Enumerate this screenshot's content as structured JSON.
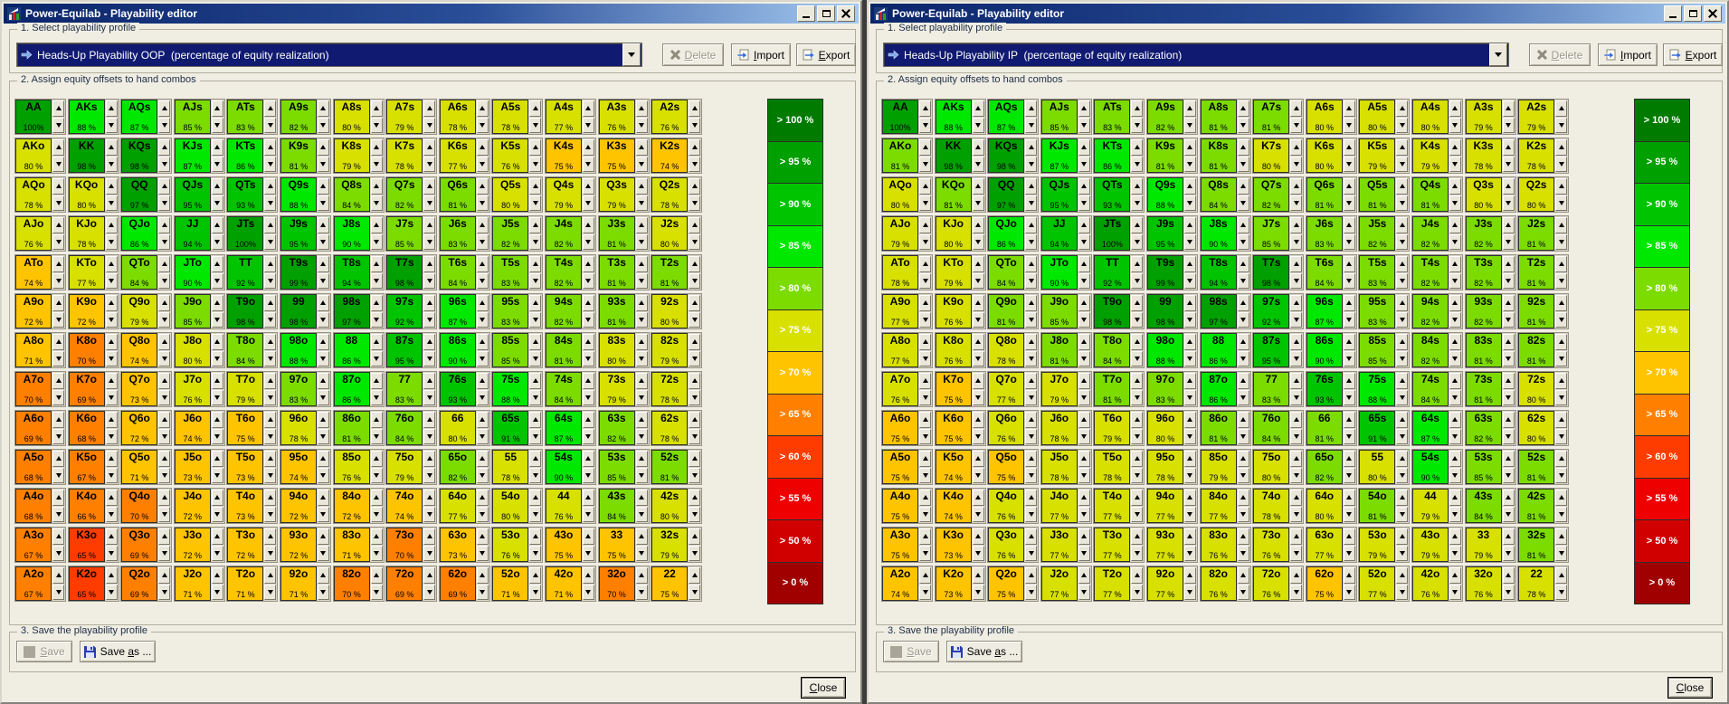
{
  "app": {
    "title": "Power-Equilab - Playability editor",
    "icons": {
      "app": "chart-icon",
      "minimize": "minimize-icon",
      "maximize": "maximize-icon",
      "close_window": "x-icon",
      "dropdown_item": "blue-arrow-icon",
      "dropdown_open": "chevron-down-icon",
      "delete": "x-icon",
      "import": "page-arrow-icon",
      "export": "page-arrow-icon",
      "save": "gray-disk-icon",
      "save_as": "floppy-disk-icon",
      "spin_up": "up-arrow-icon",
      "spin_down": "down-arrow-icon"
    }
  },
  "sections": {
    "profile": "1. Select playability profile",
    "grid": "2. Assign equity offsets to hand combos",
    "save": "3. Save the playability profile"
  },
  "buttons": {
    "delete": {
      "label": "Delete",
      "underline": 0,
      "enabled": false
    },
    "import": {
      "label": "Import",
      "underline": 0,
      "enabled": true
    },
    "export": {
      "label": "Export",
      "underline": 0,
      "enabled": true
    },
    "save": {
      "label": "Save",
      "underline": 0,
      "enabled": false
    },
    "save_as": {
      "label": "Save as ...",
      "underline": 5,
      "enabled": true
    },
    "close": {
      "label": "Close",
      "underline": 0,
      "enabled": true
    }
  },
  "legend": {
    "labels": [
      "> 100 %",
      "> 95 %",
      "> 90 %",
      "> 85 %",
      "> 80 %",
      "> 75 %",
      "> 70 %",
      "> 65 %",
      "> 60 %",
      "> 55 %",
      "> 50 %",
      "> 0 %"
    ],
    "colors": [
      "#007B00",
      "#00A000",
      "#00C400",
      "#00E800",
      "#7CDC00",
      "#D8E000",
      "#FFC400",
      "#FF8000",
      "#FF3C00",
      "#EE0000",
      "#D00000",
      "#A00000"
    ],
    "thresholds": [
      100,
      95,
      90,
      85,
      80,
      75,
      70,
      65,
      60,
      55,
      50,
      0
    ]
  },
  "hands": [
    [
      "AA",
      "AKs",
      "AQs",
      "AJs",
      "ATs",
      "A9s",
      "A8s",
      "A7s",
      "A6s",
      "A5s",
      "A4s",
      "A3s",
      "A2s"
    ],
    [
      "AKo",
      "KK",
      "KQs",
      "KJs",
      "KTs",
      "K9s",
      "K8s",
      "K7s",
      "K6s",
      "K5s",
      "K4s",
      "K3s",
      "K2s"
    ],
    [
      "AQo",
      "KQo",
      "QQ",
      "QJs",
      "QTs",
      "Q9s",
      "Q8s",
      "Q7s",
      "Q6s",
      "Q5s",
      "Q4s",
      "Q3s",
      "Q2s"
    ],
    [
      "AJo",
      "KJo",
      "QJo",
      "JJ",
      "JTs",
      "J9s",
      "J8s",
      "J7s",
      "J6s",
      "J5s",
      "J4s",
      "J3s",
      "J2s"
    ],
    [
      "ATo",
      "KTo",
      "QTo",
      "JTo",
      "TT",
      "T9s",
      "T8s",
      "T7s",
      "T6s",
      "T5s",
      "T4s",
      "T3s",
      "T2s"
    ],
    [
      "A9o",
      "K9o",
      "Q9o",
      "J9o",
      "T9o",
      "99",
      "98s",
      "97s",
      "96s",
      "95s",
      "94s",
      "93s",
      "92s"
    ],
    [
      "A8o",
      "K8o",
      "Q8o",
      "J8o",
      "T8o",
      "98o",
      "88",
      "87s",
      "86s",
      "85s",
      "84s",
      "83s",
      "82s"
    ],
    [
      "A7o",
      "K7o",
      "Q7o",
      "J7o",
      "T7o",
      "97o",
      "87o",
      "77",
      "76s",
      "75s",
      "74s",
      "73s",
      "72s"
    ],
    [
      "A6o",
      "K6o",
      "Q6o",
      "J6o",
      "T6o",
      "96o",
      "86o",
      "76o",
      "66",
      "65s",
      "64s",
      "63s",
      "62s"
    ],
    [
      "A5o",
      "K5o",
      "Q5o",
      "J5o",
      "T5o",
      "95o",
      "85o",
      "75o",
      "65o",
      "55",
      "54s",
      "53s",
      "52s"
    ],
    [
      "A4o",
      "K4o",
      "Q4o",
      "J4o",
      "T4o",
      "94o",
      "84o",
      "74o",
      "64o",
      "54o",
      "44",
      "43s",
      "42s"
    ],
    [
      "A3o",
      "K3o",
      "Q3o",
      "J3o",
      "T3o",
      "93o",
      "83o",
      "73o",
      "63o",
      "53o",
      "43o",
      "33",
      "32s"
    ],
    [
      "A2o",
      "K2o",
      "Q2o",
      "J2o",
      "T2o",
      "92o",
      "82o",
      "72o",
      "62o",
      "52o",
      "42o",
      "32o",
      "22"
    ]
  ],
  "windows": [
    {
      "title": "Power-Equilab - Playability editor",
      "profile": "Heads-Up Playability OOP  (percentage of equity realization)",
      "values": [
        [
          100,
          88,
          87,
          85,
          83,
          82,
          80,
          79,
          78,
          78,
          77,
          76,
          76
        ],
        [
          80,
          98,
          98,
          87,
          86,
          81,
          79,
          78,
          77,
          76,
          75,
          75,
          74
        ],
        [
          78,
          80,
          97,
          95,
          93,
          88,
          84,
          82,
          81,
          80,
          79,
          79,
          78
        ],
        [
          76,
          78,
          86,
          94,
          100,
          95,
          90,
          85,
          83,
          82,
          82,
          81,
          80
        ],
        [
          74,
          77,
          84,
          90,
          92,
          99,
          94,
          98,
          84,
          83,
          82,
          81,
          81
        ],
        [
          72,
          72,
          79,
          85,
          98,
          98,
          97,
          92,
          87,
          83,
          82,
          81,
          80
        ],
        [
          71,
          70,
          74,
          80,
          84,
          88,
          86,
          95,
          90,
          85,
          81,
          80,
          79
        ],
        [
          70,
          69,
          73,
          76,
          79,
          83,
          86,
          83,
          93,
          88,
          84,
          79,
          78
        ],
        [
          69,
          68,
          72,
          74,
          75,
          78,
          81,
          84,
          80,
          91,
          87,
          82,
          78
        ],
        [
          68,
          67,
          71,
          73,
          73,
          74,
          76,
          79,
          82,
          78,
          90,
          85,
          81
        ],
        [
          68,
          66,
          70,
          72,
          73,
          72,
          72,
          74,
          77,
          80,
          76,
          84,
          80
        ],
        [
          67,
          65,
          69,
          72,
          72,
          72,
          71,
          70,
          73,
          76,
          75,
          75,
          79
        ],
        [
          67,
          65,
          69,
          71,
          71,
          71,
          70,
          69,
          69,
          71,
          71,
          70,
          75
        ]
      ]
    },
    {
      "title": "Power-Equilab - Playability editor",
      "profile": "Heads-Up Playability IP  (percentage of equity realization)",
      "values": [
        [
          100,
          88,
          87,
          85,
          83,
          82,
          81,
          81,
          80,
          80,
          80,
          79,
          79
        ],
        [
          81,
          98,
          98,
          87,
          86,
          81,
          81,
          80,
          80,
          79,
          79,
          78,
          78
        ],
        [
          80,
          81,
          97,
          95,
          93,
          88,
          84,
          82,
          81,
          81,
          81,
          80,
          80
        ],
        [
          79,
          80,
          86,
          94,
          100,
          95,
          90,
          85,
          83,
          82,
          82,
          82,
          81
        ],
        [
          78,
          79,
          84,
          90,
          92,
          99,
          94,
          98,
          84,
          83,
          82,
          82,
          81
        ],
        [
          77,
          76,
          81,
          85,
          98,
          98,
          97,
          92,
          87,
          83,
          82,
          82,
          81
        ],
        [
          77,
          76,
          78,
          81,
          84,
          88,
          86,
          95,
          90,
          85,
          82,
          81,
          81
        ],
        [
          76,
          75,
          77,
          79,
          81,
          83,
          86,
          83,
          93,
          88,
          84,
          81,
          80
        ],
        [
          75,
          75,
          76,
          78,
          79,
          80,
          81,
          84,
          81,
          91,
          87,
          82,
          80
        ],
        [
          75,
          74,
          75,
          78,
          78,
          78,
          79,
          80,
          82,
          80,
          90,
          85,
          81
        ],
        [
          75,
          74,
          76,
          77,
          77,
          77,
          77,
          78,
          80,
          81,
          79,
          84,
          81
        ],
        [
          75,
          73,
          76,
          77,
          77,
          77,
          76,
          76,
          77,
          79,
          79,
          79,
          81
        ],
        [
          74,
          73,
          75,
          77,
          77,
          77,
          76,
          76,
          75,
          77,
          76,
          76,
          78
        ]
      ]
    }
  ]
}
